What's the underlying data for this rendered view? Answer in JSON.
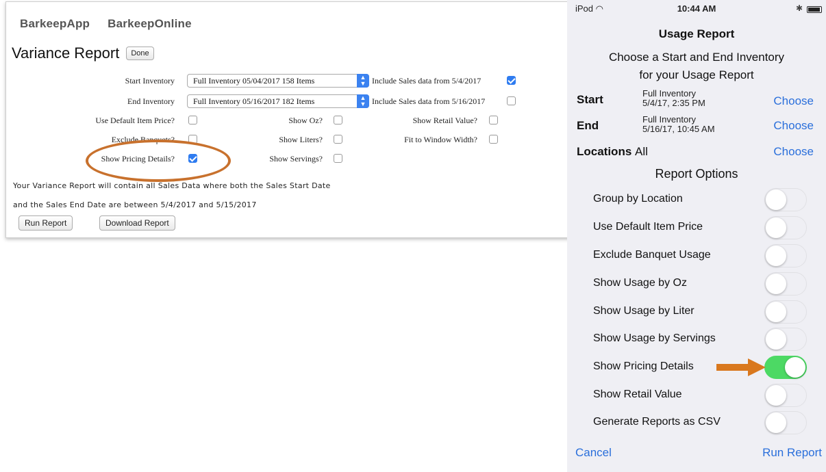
{
  "web": {
    "nav": [
      "BarkeepApp",
      "BarkeepOnline"
    ],
    "title": "Variance Report",
    "done_label": "Done",
    "start_inventory_label": "Start Inventory",
    "start_inventory_value": "Full Inventory 05/04/2017 158 Items",
    "start_include_label": "Include Sales data from 5/4/2017",
    "end_inventory_label": "End Inventory",
    "end_inventory_value": "Full Inventory 05/16/2017 182 Items",
    "end_include_label": "Include Sales data from 5/16/2017",
    "options": {
      "use_default_price": "Use Default Item Price?",
      "exclude_banquets": "Exclude Banquets?",
      "show_pricing_details": "Show Pricing Details?",
      "show_oz": "Show Oz?",
      "show_liters": "Show Liters?",
      "show_servings": "Show Servings?",
      "show_retail_value": "Show Retail Value?",
      "fit_to_window": "Fit to Window Width?"
    },
    "note_line1": "Your Variance Report will contain all Sales Data where both the Sales Start Date",
    "note_line2": "and the Sales End Date are between 5/4/2017 and 5/15/2017",
    "run_report_label": "Run Report",
    "download_report_label": "Download Report"
  },
  "phone": {
    "status_carrier": "iPod",
    "status_time": "10:44 AM",
    "title": "Usage Report",
    "subtitle_line1": "Choose a Start and End Inventory",
    "subtitle_line2": "for your Usage Report",
    "start_label": "Start",
    "start_inv_name": "Full Inventory",
    "start_inv_date": "5/4/17, 2:35 PM",
    "end_label": "End",
    "end_inv_name": "Full Inventory",
    "end_inv_date": "5/16/17, 10:45 AM",
    "locations_label": "Locations",
    "locations_value": "All",
    "choose_label": "Choose",
    "section_title": "Report Options",
    "options": [
      {
        "label": "Group by Location",
        "on": false
      },
      {
        "label": "Use Default Item Price",
        "on": false
      },
      {
        "label": "Exclude Banquet Usage",
        "on": false
      },
      {
        "label": "Show Usage by Oz",
        "on": false
      },
      {
        "label": "Show Usage by Liter",
        "on": false
      },
      {
        "label": "Show Usage by Servings",
        "on": false
      },
      {
        "label": "Show Pricing Details",
        "on": true
      },
      {
        "label": "Show Retail Value",
        "on": false
      },
      {
        "label": "Generate Reports as CSV",
        "on": false
      }
    ],
    "cancel_label": "Cancel",
    "run_report_label": "Run Report"
  },
  "colors": {
    "accent_blue": "#2a6fdb",
    "toggle_on": "#4cd964",
    "annotation_orange": "#c8712d"
  }
}
